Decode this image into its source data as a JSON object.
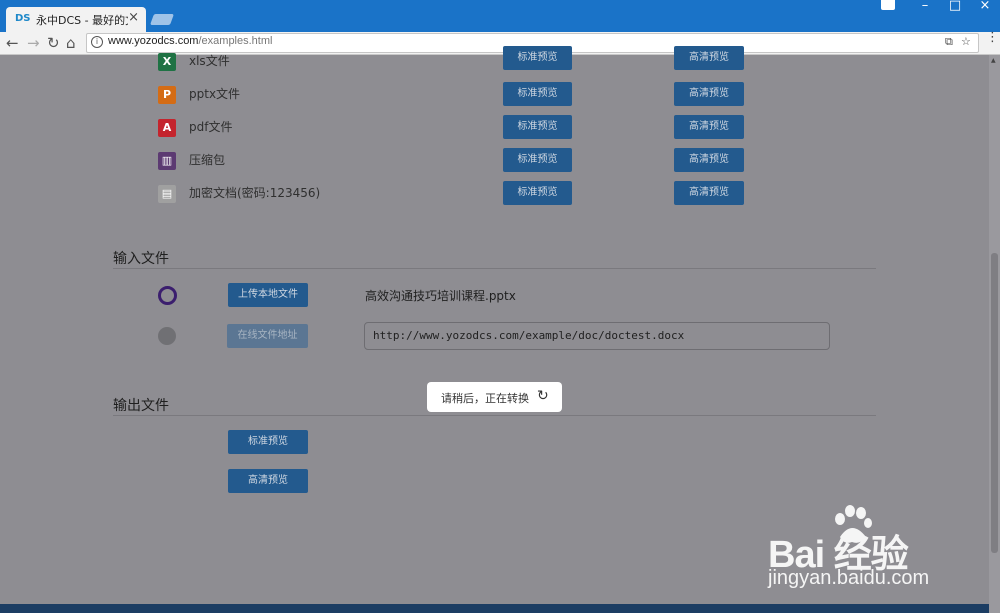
{
  "browser": {
    "tab_title": "永中DCS - 最好的文档在",
    "tab_favicon": "DS",
    "close_glyph": "×",
    "url_domain": "www.yozodcs.com",
    "url_path": "/examples.html",
    "win_min": "–",
    "win_max": "□",
    "win_close": "×",
    "nav_back": "←",
    "nav_forward": "→",
    "nav_reload": "↻",
    "nav_home": "⌂",
    "star_glyph": "☆",
    "translate_glyph": "⧉",
    "menu_glyph": "⋮"
  },
  "files": [
    {
      "name": "xls文件",
      "icon": "excel-icon",
      "glyph": "X",
      "color": "#1f7244",
      "std": "标准预览",
      "hd": "高清预览"
    },
    {
      "name": "pptx文件",
      "icon": "powerpoint-icon",
      "glyph": "P",
      "color": "#d46c15",
      "std": "标准预览",
      "hd": "高清预览"
    },
    {
      "name": "pdf文件",
      "icon": "pdf-icon",
      "glyph": "A",
      "color": "#c4242d",
      "std": "标准预览",
      "hd": "高清预览"
    },
    {
      "name": "压缩包",
      "icon": "archive-icon",
      "glyph": "▥",
      "color": "#5c3a72",
      "std": "标准预览",
      "hd": "高清预览"
    },
    {
      "name": "加密文档(密码:123456)",
      "icon": "locked-document-icon",
      "glyph": "▤",
      "color": "#a0a0a0",
      "std": "标准预览",
      "hd": "高清预览"
    }
  ],
  "input_section": {
    "title": "输入文件",
    "upload_button": "上传本地文件",
    "uploaded_file": "高效沟通技巧培训课程.pptx",
    "online_button": "在线文件地址",
    "online_url": "http://www.yozodcs.com/example/doc/doctest.docx"
  },
  "output_section": {
    "title": "输出文件",
    "std_button": "标准预览",
    "hd_button": "高清预览"
  },
  "toast": {
    "text": "请稍后，正在转换",
    "spinner": "↻"
  },
  "watermark": {
    "big": "Bai  经验",
    "small": "jingyan.baidu.com"
  }
}
